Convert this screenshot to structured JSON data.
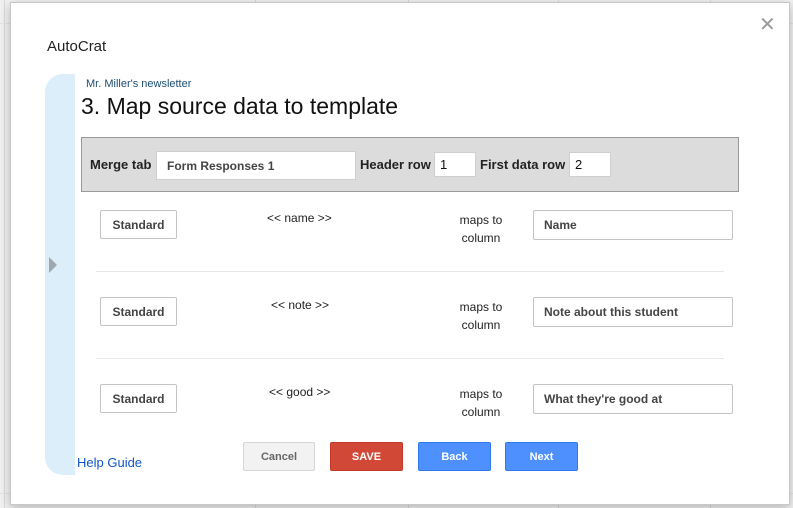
{
  "dialog": {
    "title": "AutoCrat",
    "close_icon": "close-icon",
    "subtitle": "Mr. Miller's newsletter",
    "heading": "3. Map source data to template",
    "help_link": "Help Guide"
  },
  "merge": {
    "merge_tab_label": "Merge tab",
    "merge_tab_value": "Form Responses 1",
    "header_row_label": "Header row",
    "header_row_value": "1",
    "first_data_row_label": "First data row",
    "first_data_row_value": "2"
  },
  "mappings": [
    {
      "type": "Standard",
      "tag": "<< name >>",
      "maps_line1": "maps to",
      "maps_line2": "column",
      "column": "Name"
    },
    {
      "type": "Standard",
      "tag": "<< note >>",
      "maps_line1": "maps to",
      "maps_line2": "column",
      "column": "Note about this student"
    },
    {
      "type": "Standard",
      "tag": "<< good >>",
      "maps_line1": "maps to",
      "maps_line2": "column",
      "column": "What they're good at"
    }
  ],
  "buttons": {
    "cancel": "Cancel",
    "save": "SAVE",
    "back": "Back",
    "next": "Next"
  },
  "colors": {
    "save": "#d14836",
    "primary": "#4d90fe",
    "side_panel": "#dbeefa",
    "link": "#1155cc"
  }
}
